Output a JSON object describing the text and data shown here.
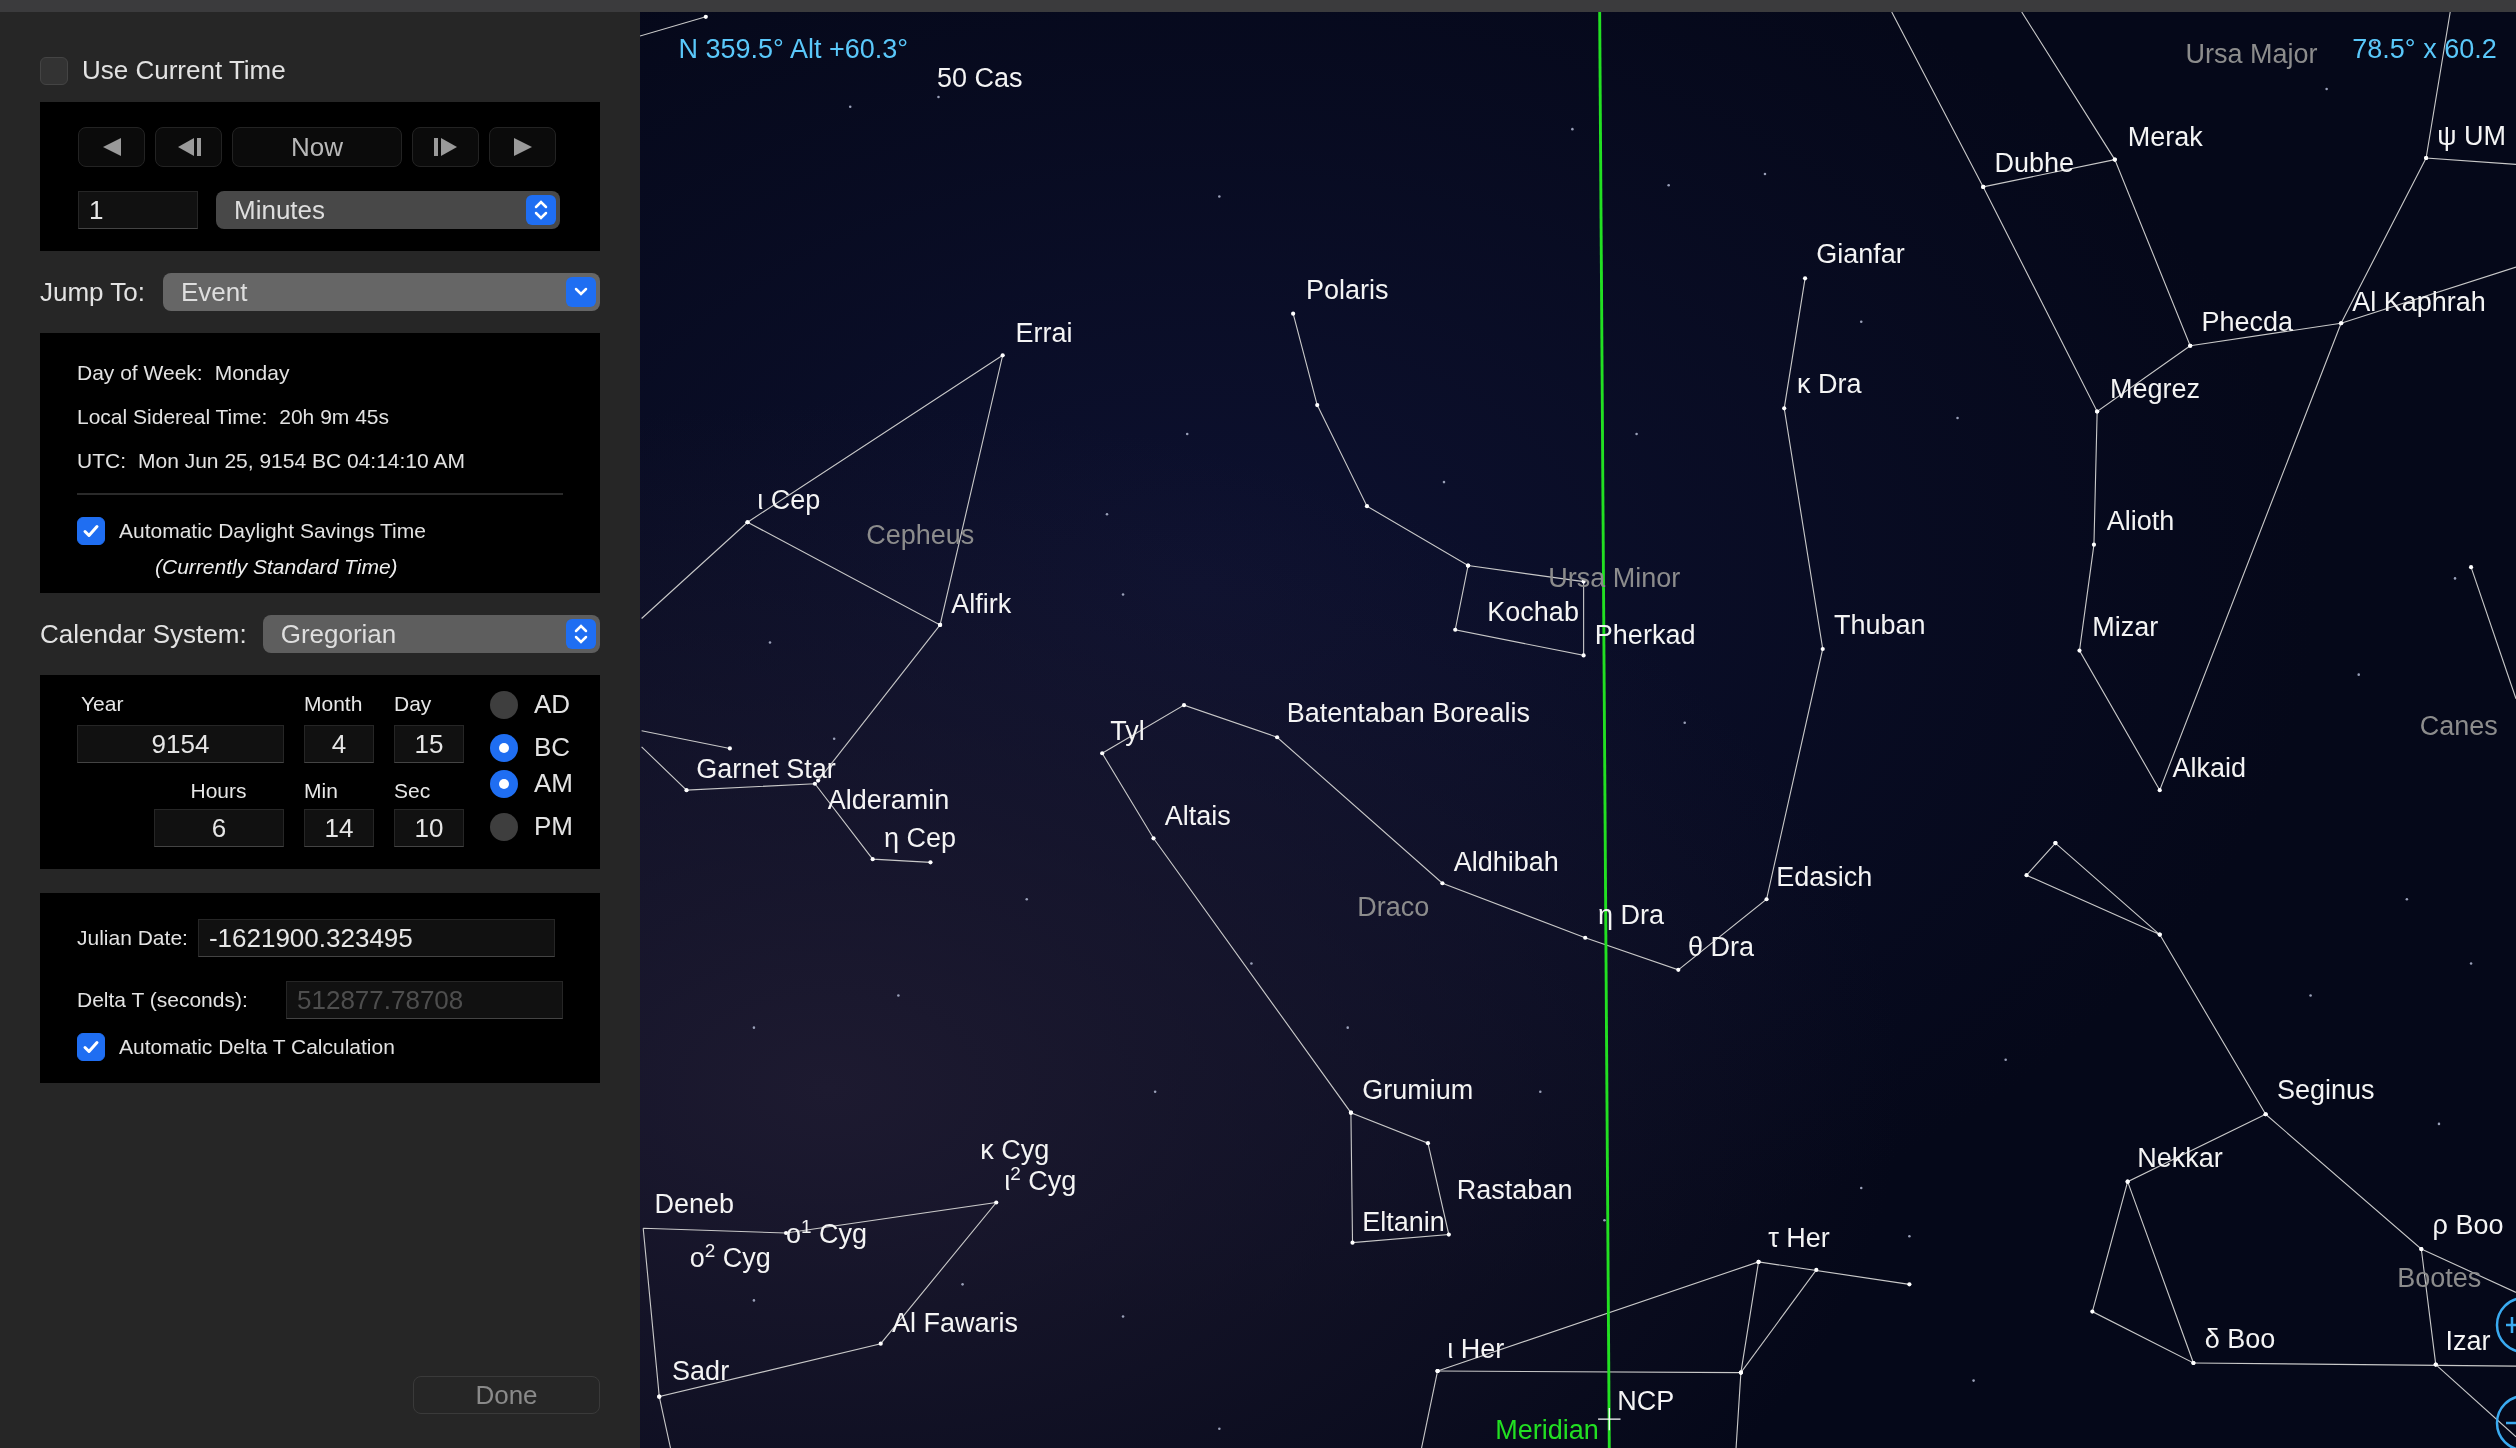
{
  "use_current_time": {
    "label": "Use Current Time",
    "checked": false
  },
  "step_controls": {
    "buttons": [
      {
        "kind": "rewind"
      },
      {
        "kind": "step-back"
      },
      {
        "kind": "text",
        "label": "Now"
      },
      {
        "kind": "step-forward"
      },
      {
        "kind": "forward"
      }
    ],
    "amount": "1",
    "unit": "Minutes"
  },
  "jump_to": {
    "label": "Jump To:",
    "value": "Event"
  },
  "info": {
    "lines": [
      {
        "label": "Day of Week:",
        "value": "Monday"
      },
      {
        "label": "Local Sidereal Time:",
        "value": "20h 9m 45s"
      },
      {
        "label": "UTC:",
        "value": "Mon Jun 25, 9154 BC 04:14:10 AM"
      }
    ],
    "dst": {
      "label": "Automatic Daylight Savings Time",
      "checked": true,
      "note": "(Currently Standard Time)"
    }
  },
  "calendar": {
    "label": "Calendar System:",
    "value": "Gregorian"
  },
  "date_fields": {
    "date": [
      {
        "label": "Year",
        "value": "9154"
      },
      {
        "label": "Month",
        "value": "4"
      },
      {
        "label": "Day",
        "value": "15"
      }
    ],
    "time": [
      {
        "label": "Hours",
        "value": "6"
      },
      {
        "label": "Min",
        "value": "14"
      },
      {
        "label": "Sec",
        "value": "10"
      }
    ],
    "era": [
      {
        "label": "AD",
        "selected": false
      },
      {
        "label": "BC",
        "selected": true
      }
    ],
    "meridiem": [
      {
        "label": "AM",
        "selected": true
      },
      {
        "label": "PM",
        "selected": false
      }
    ]
  },
  "julian": {
    "label": "Julian Date:",
    "value": "-1621900.323495"
  },
  "delta_t": {
    "label": "Delta T (seconds):",
    "value": "512877.78708",
    "disabled": true
  },
  "auto_delta_t": {
    "label": "Automatic Delta T Calculation",
    "checked": true
  },
  "done_button": {
    "label": "Done"
  },
  "sky": {
    "readouts": [
      "N 359.5° Alt +60.3°",
      "78.5° x 60.2"
    ],
    "labels": [
      {
        "text": "50 Cas",
        "kind": "star"
      },
      {
        "text": "Ursa Major",
        "kind": "constellation"
      },
      {
        "text": "ψ UM",
        "kind": "star"
      },
      {
        "text": "Merak",
        "kind": "star"
      },
      {
        "text": "Dubhe",
        "kind": "star"
      },
      {
        "text": "Gianfar",
        "kind": "star"
      },
      {
        "text": "Polaris",
        "kind": "star"
      },
      {
        "text": "Al Kaphrah",
        "kind": "star"
      },
      {
        "text": "Phecda",
        "kind": "star"
      },
      {
        "text": "Errai",
        "kind": "star"
      },
      {
        "text": "κ Dra",
        "kind": "star"
      },
      {
        "text": "Megrez",
        "kind": "star"
      },
      {
        "text": "ι Cep",
        "kind": "star"
      },
      {
        "text": "Alioth",
        "kind": "star"
      },
      {
        "text": "Cepheus",
        "kind": "constellation"
      },
      {
        "text": "Ursa Minor",
        "kind": "constellation"
      },
      {
        "text": "Alfirk",
        "kind": "star"
      },
      {
        "text": "Kochab",
        "kind": "star"
      },
      {
        "text": "Thuban",
        "kind": "star"
      },
      {
        "text": "Mizar",
        "kind": "star"
      },
      {
        "text": "Pherkad",
        "kind": "star"
      },
      {
        "text": "Batentaban Borealis",
        "kind": "star"
      },
      {
        "text": "Tyl",
        "kind": "star"
      },
      {
        "text": "Canes",
        "kind": "constellation"
      },
      {
        "text": "Alkaid",
        "kind": "star"
      },
      {
        "text": "Garnet Star",
        "kind": "star"
      },
      {
        "text": "Alderamin",
        "kind": "star"
      },
      {
        "text": "Altais",
        "kind": "star"
      },
      {
        "text": "η Cep",
        "kind": "star"
      },
      {
        "text": "Aldhibah",
        "kind": "star"
      },
      {
        "text": "Edasich",
        "kind": "star"
      },
      {
        "text": "Draco",
        "kind": "constellation"
      },
      {
        "text": "η Dra",
        "kind": "star"
      },
      {
        "text": "θ Dra",
        "kind": "star"
      },
      {
        "text": "Grumium",
        "kind": "star"
      },
      {
        "text": "Seginus",
        "kind": "star"
      },
      {
        "text": "κ Cyg",
        "kind": "star"
      },
      {
        "text": "Nekkar",
        "kind": "star"
      },
      {
        "text": "ι$^{2}$ Cyg",
        "kind": "star"
      },
      {
        "text": "Rastaban",
        "kind": "star"
      },
      {
        "text": "Deneb",
        "kind": "star"
      },
      {
        "text": "ο$^{1}$ Cyg",
        "kind": "star"
      },
      {
        "text": "Eltanin",
        "kind": "star"
      },
      {
        "text": "τ Her",
        "kind": "star"
      },
      {
        "text": "ρ Boo",
        "kind": "star"
      },
      {
        "text": "ο$^{2}$ Cyg",
        "kind": "star"
      },
      {
        "text": "Bootes",
        "kind": "constellation"
      },
      {
        "text": "Al Fawaris",
        "kind": "star"
      },
      {
        "text": "δ Boo",
        "kind": "star"
      },
      {
        "text": "Izar",
        "kind": "star"
      },
      {
        "text": "ι Her",
        "kind": "star"
      },
      {
        "text": "Sadr",
        "kind": "star"
      },
      {
        "text": "NCP",
        "kind": "star"
      },
      {
        "text": "Meridian",
        "kind": "guide"
      }
    ]
  }
}
